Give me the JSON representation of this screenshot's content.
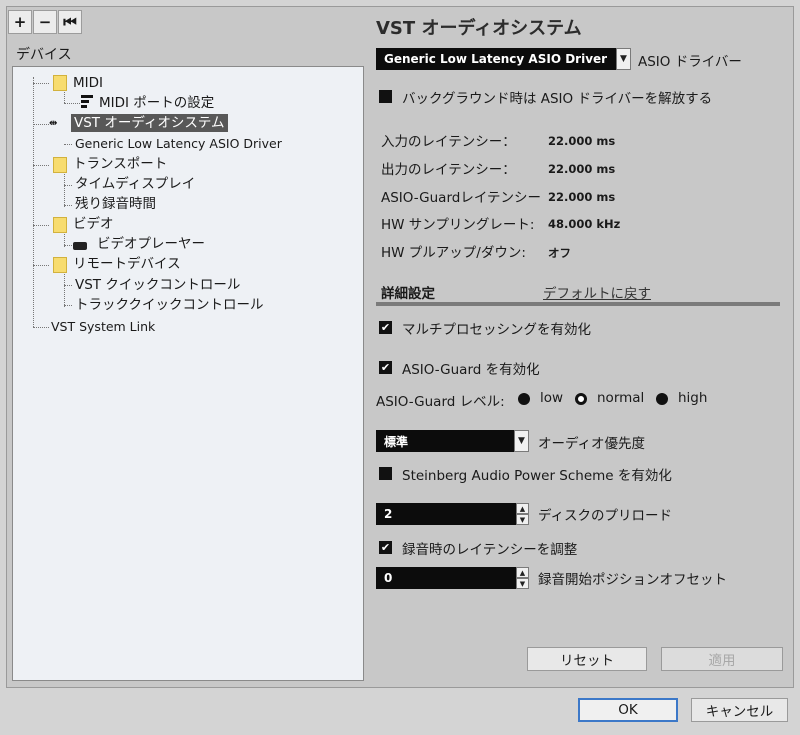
{
  "toolbar": {
    "add": "+",
    "remove": "−",
    "reset": "⏮"
  },
  "devices_label": "デバイス",
  "tree": {
    "midi": "MIDI",
    "midi_port": "MIDI ポートの設定",
    "vst_audio": "VST オーディオシステム",
    "generic_driver": "Generic Low Latency ASIO Driver",
    "transport": "トランスポート",
    "time_display": "タイムディスプレイ",
    "remaining_time": "残り録音時間",
    "video": "ビデオ",
    "video_player": "ビデオプレーヤー",
    "remote": "リモートデバイス",
    "vst_quick": "VST クイックコントロール",
    "track_quick": "トラッククイックコントロール",
    "system_link": "VST System Link"
  },
  "panel": {
    "title": "VST オーディオシステム",
    "driver_select": "Generic Low Latency ASIO Driver",
    "driver_label": "ASIO ドライバー",
    "release_driver_label": "バックグラウンド時は ASIO ドライバーを解放する",
    "latency": [
      {
        "label": "入力のレイテンシー：",
        "value": "22.000 ms"
      },
      {
        "label": "出力のレイテンシー：",
        "value": "22.000 ms"
      },
      {
        "label": "ASIO-Guardレイテンシー",
        "value": "22.000 ms"
      },
      {
        "label": "HW サンプリングレート:",
        "value": "48.000 kHz"
      },
      {
        "label": "HW プルアップ/ダウン:",
        "value": "オフ"
      }
    ],
    "advanced_label": "詳細設定",
    "reset_default_link": "デフォルトに戻す",
    "multiprocessing_label": "マルチプロセッシングを有効化",
    "asio_guard_label": "ASIO-Guard を有効化",
    "asio_guard_level_label": "ASIO-Guard レベル:",
    "levels": [
      "low",
      "normal",
      "high"
    ],
    "priority_select": "標準",
    "priority_label": "オーディオ優先度",
    "power_scheme_label": "Steinberg Audio Power Scheme を有効化",
    "disk_preload_value": "2",
    "disk_preload_label": "ディスクのプリロード",
    "adjust_latency_label": "録音時のレイテンシーを調整",
    "record_offset_value": "0",
    "record_offset_label": "録音開始ポジションオフセット",
    "reset_button": "リセット",
    "apply_button": "適用"
  },
  "dialog": {
    "ok": "OK",
    "cancel": "キャンセル"
  },
  "icons": {
    "check": "✔",
    "down": "▼",
    "up": "▲"
  }
}
